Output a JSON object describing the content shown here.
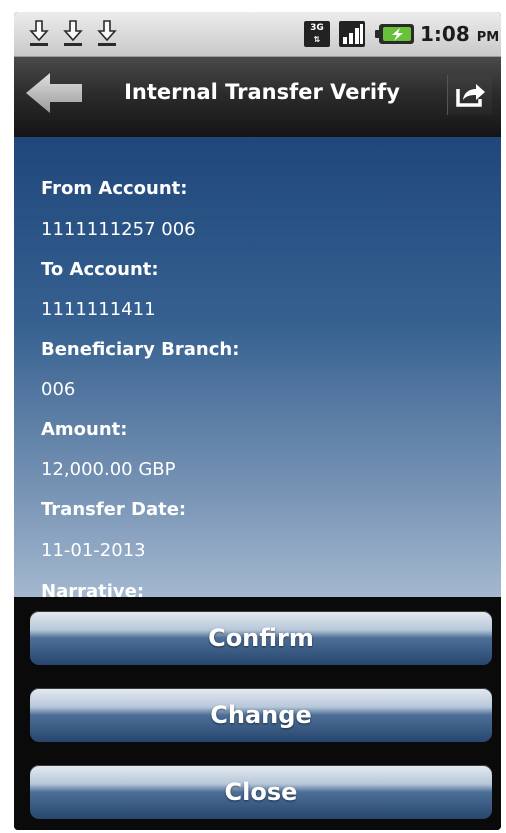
{
  "status_bar": {
    "network_type": "3G",
    "time": "1:08",
    "ampm": "PM",
    "icons": [
      "download-icon",
      "download-icon",
      "download-icon",
      "3g-icon",
      "signal-icon",
      "battery-icon"
    ]
  },
  "header": {
    "title": "Internal Transfer Verify",
    "back_icon": "back-arrow-icon",
    "share_icon": "share-icon"
  },
  "details": {
    "from_account_label": "From Account:",
    "from_account_value": "1111111257  006",
    "to_account_label": "To Account:",
    "to_account_value": "1111111411",
    "beneficiary_branch_label": "Beneficiary Branch:",
    "beneficiary_branch_value": "006",
    "amount_label": "Amount:",
    "amount_value": "12,000.00 GBP",
    "transfer_date_label": "Transfer Date:",
    "transfer_date_value": "11-01-2013",
    "narrative_label": "Narrative:"
  },
  "actions": {
    "confirm_label": "Confirm",
    "change_label": "Change",
    "close_label": "Close"
  },
  "colors": {
    "content_top": "#20477c",
    "content_bottom": "#a4b8cf",
    "button_dark": "#27466e",
    "title_bar": "#2c2c2c"
  }
}
